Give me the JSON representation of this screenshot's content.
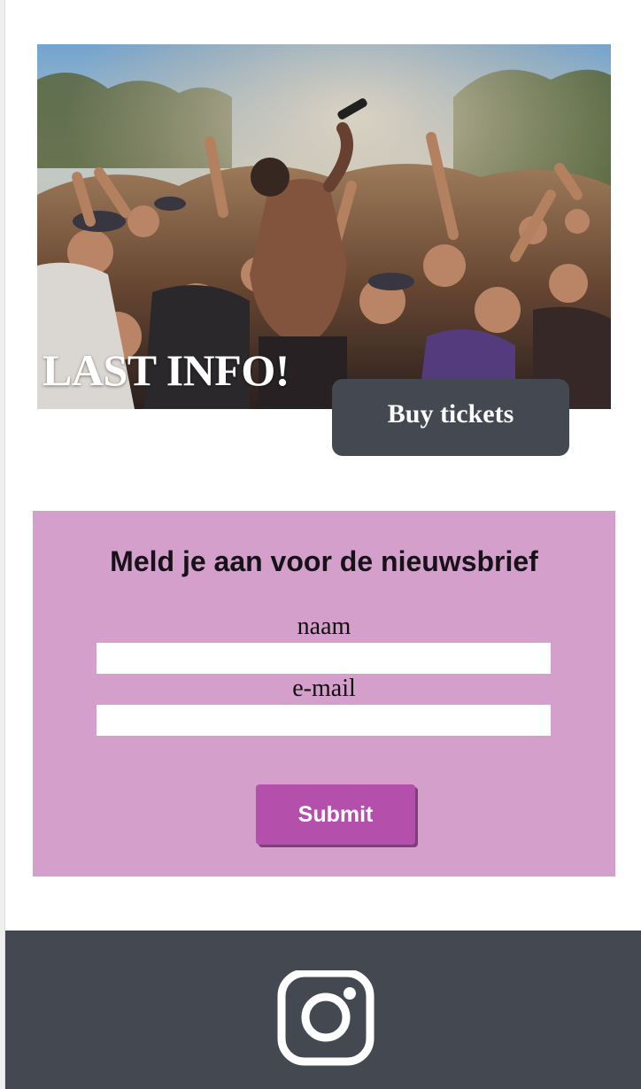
{
  "hero": {
    "title": "LAST INFO!",
    "image_description_icon": "concert-crowd-photo"
  },
  "buy_button": {
    "label": "Buy tickets"
  },
  "newsletter": {
    "title": "Meld je aan voor de nieuwsbrief",
    "name_label": "naam",
    "name_value": "",
    "email_label": "e-mail",
    "email_value": "",
    "submit_label": "Submit"
  },
  "footer": {
    "social_icon": "instagram-icon"
  },
  "colors": {
    "dark_gray": "#434851",
    "newsletter_bg": "#d59fcc",
    "submit_bg": "#b44fac",
    "white": "#ffffff"
  }
}
